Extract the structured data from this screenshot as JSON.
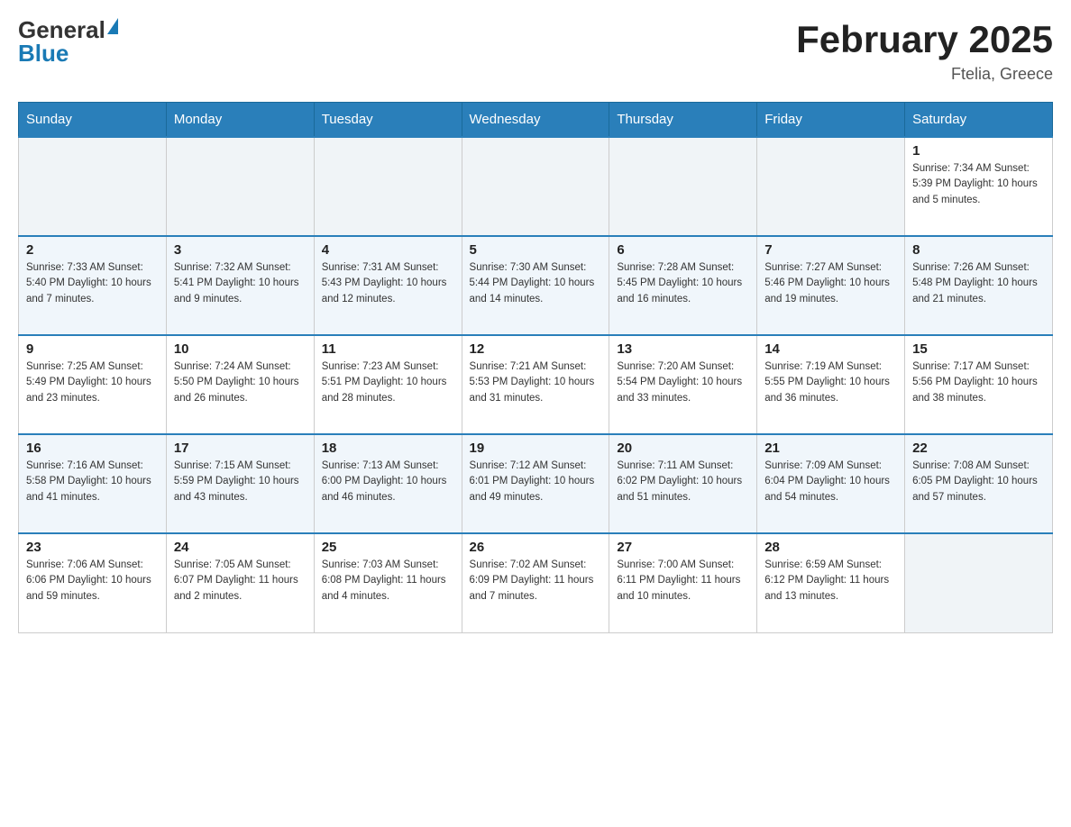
{
  "header": {
    "logo": {
      "general": "General",
      "blue": "Blue"
    },
    "title": "February 2025",
    "location": "Ftelia, Greece"
  },
  "days_of_week": [
    "Sunday",
    "Monday",
    "Tuesday",
    "Wednesday",
    "Thursday",
    "Friday",
    "Saturday"
  ],
  "weeks": [
    [
      {
        "day": "",
        "info": ""
      },
      {
        "day": "",
        "info": ""
      },
      {
        "day": "",
        "info": ""
      },
      {
        "day": "",
        "info": ""
      },
      {
        "day": "",
        "info": ""
      },
      {
        "day": "",
        "info": ""
      },
      {
        "day": "1",
        "info": "Sunrise: 7:34 AM\nSunset: 5:39 PM\nDaylight: 10 hours\nand 5 minutes."
      }
    ],
    [
      {
        "day": "2",
        "info": "Sunrise: 7:33 AM\nSunset: 5:40 PM\nDaylight: 10 hours\nand 7 minutes."
      },
      {
        "day": "3",
        "info": "Sunrise: 7:32 AM\nSunset: 5:41 PM\nDaylight: 10 hours\nand 9 minutes."
      },
      {
        "day": "4",
        "info": "Sunrise: 7:31 AM\nSunset: 5:43 PM\nDaylight: 10 hours\nand 12 minutes."
      },
      {
        "day": "5",
        "info": "Sunrise: 7:30 AM\nSunset: 5:44 PM\nDaylight: 10 hours\nand 14 minutes."
      },
      {
        "day": "6",
        "info": "Sunrise: 7:28 AM\nSunset: 5:45 PM\nDaylight: 10 hours\nand 16 minutes."
      },
      {
        "day": "7",
        "info": "Sunrise: 7:27 AM\nSunset: 5:46 PM\nDaylight: 10 hours\nand 19 minutes."
      },
      {
        "day": "8",
        "info": "Sunrise: 7:26 AM\nSunset: 5:48 PM\nDaylight: 10 hours\nand 21 minutes."
      }
    ],
    [
      {
        "day": "9",
        "info": "Sunrise: 7:25 AM\nSunset: 5:49 PM\nDaylight: 10 hours\nand 23 minutes."
      },
      {
        "day": "10",
        "info": "Sunrise: 7:24 AM\nSunset: 5:50 PM\nDaylight: 10 hours\nand 26 minutes."
      },
      {
        "day": "11",
        "info": "Sunrise: 7:23 AM\nSunset: 5:51 PM\nDaylight: 10 hours\nand 28 minutes."
      },
      {
        "day": "12",
        "info": "Sunrise: 7:21 AM\nSunset: 5:53 PM\nDaylight: 10 hours\nand 31 minutes."
      },
      {
        "day": "13",
        "info": "Sunrise: 7:20 AM\nSunset: 5:54 PM\nDaylight: 10 hours\nand 33 minutes."
      },
      {
        "day": "14",
        "info": "Sunrise: 7:19 AM\nSunset: 5:55 PM\nDaylight: 10 hours\nand 36 minutes."
      },
      {
        "day": "15",
        "info": "Sunrise: 7:17 AM\nSunset: 5:56 PM\nDaylight: 10 hours\nand 38 minutes."
      }
    ],
    [
      {
        "day": "16",
        "info": "Sunrise: 7:16 AM\nSunset: 5:58 PM\nDaylight: 10 hours\nand 41 minutes."
      },
      {
        "day": "17",
        "info": "Sunrise: 7:15 AM\nSunset: 5:59 PM\nDaylight: 10 hours\nand 43 minutes."
      },
      {
        "day": "18",
        "info": "Sunrise: 7:13 AM\nSunset: 6:00 PM\nDaylight: 10 hours\nand 46 minutes."
      },
      {
        "day": "19",
        "info": "Sunrise: 7:12 AM\nSunset: 6:01 PM\nDaylight: 10 hours\nand 49 minutes."
      },
      {
        "day": "20",
        "info": "Sunrise: 7:11 AM\nSunset: 6:02 PM\nDaylight: 10 hours\nand 51 minutes."
      },
      {
        "day": "21",
        "info": "Sunrise: 7:09 AM\nSunset: 6:04 PM\nDaylight: 10 hours\nand 54 minutes."
      },
      {
        "day": "22",
        "info": "Sunrise: 7:08 AM\nSunset: 6:05 PM\nDaylight: 10 hours\nand 57 minutes."
      }
    ],
    [
      {
        "day": "23",
        "info": "Sunrise: 7:06 AM\nSunset: 6:06 PM\nDaylight: 10 hours\nand 59 minutes."
      },
      {
        "day": "24",
        "info": "Sunrise: 7:05 AM\nSunset: 6:07 PM\nDaylight: 11 hours\nand 2 minutes."
      },
      {
        "day": "25",
        "info": "Sunrise: 7:03 AM\nSunset: 6:08 PM\nDaylight: 11 hours\nand 4 minutes."
      },
      {
        "day": "26",
        "info": "Sunrise: 7:02 AM\nSunset: 6:09 PM\nDaylight: 11 hours\nand 7 minutes."
      },
      {
        "day": "27",
        "info": "Sunrise: 7:00 AM\nSunset: 6:11 PM\nDaylight: 11 hours\nand 10 minutes."
      },
      {
        "day": "28",
        "info": "Sunrise: 6:59 AM\nSunset: 6:12 PM\nDaylight: 11 hours\nand 13 minutes."
      },
      {
        "day": "",
        "info": ""
      }
    ]
  ]
}
